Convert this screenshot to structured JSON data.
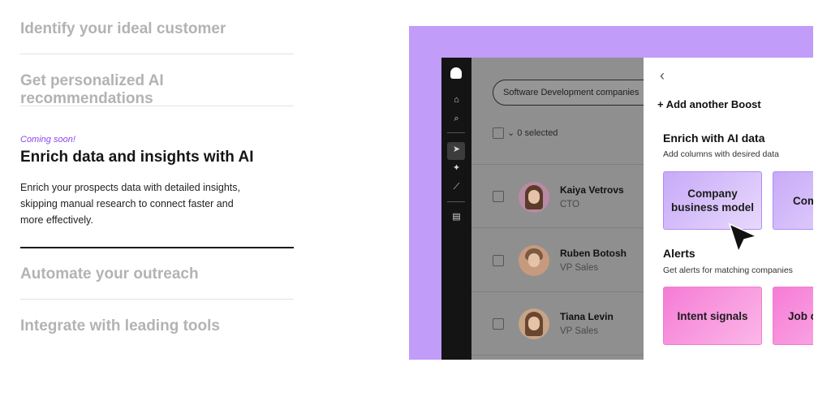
{
  "features": {
    "item1": "Identify your ideal customer",
    "item2": "Get personalized AI recommendations",
    "coming_soon": "Coming soon!",
    "active_title": "Enrich data and insights with AI",
    "active_desc": "Enrich your prospects data with detailed insights, skipping manual research to connect faster and more effectively.",
    "item4": "Automate your outreach",
    "item5": "Integrate with leading tools"
  },
  "mockup": {
    "search_pill": "Software Development companies",
    "selected": "0 selected",
    "people": [
      {
        "name": "Kaiya Vetrovs",
        "role": "CTO"
      },
      {
        "name": "Ruben Botosh",
        "role": "VP Sales"
      },
      {
        "name": "Tiana Levin",
        "role": "VP Sales"
      }
    ],
    "panel": {
      "back": "‹",
      "add_boost": "+ Add another Boost",
      "enrich_title": "Enrich with AI data",
      "enrich_sub": "Add columns with desired data",
      "card1": "Company business model",
      "card2": "Com signa",
      "alerts_title": "Alerts",
      "alerts_sub": "Get alerts for matching companies",
      "card3": "Intent signals",
      "card4": "Job c"
    }
  }
}
